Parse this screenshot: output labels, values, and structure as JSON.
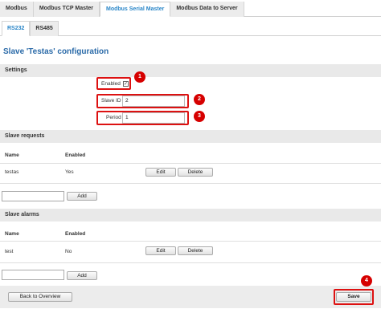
{
  "top_tabs": [
    "Modbus",
    "Modbus TCP Master",
    "Modbus Serial Master",
    "Modbus Data to Server"
  ],
  "sub_tabs": [
    "RS232",
    "RS485"
  ],
  "page_title": "Slave 'Testas' configuration",
  "settings": {
    "heading": "Settings",
    "enabled_label": "Enabled",
    "enabled_checked": true,
    "slave_id_label": "Slave ID",
    "slave_id_value": "2",
    "period_label": "Period",
    "period_value": "1"
  },
  "markers": [
    "1",
    "2",
    "3",
    "4"
  ],
  "slave_requests": {
    "heading": "Slave requests",
    "col_name": "Name",
    "col_enabled": "Enabled",
    "rows": [
      {
        "name": "testas",
        "enabled": "Yes"
      }
    ],
    "edit_label": "Edit",
    "delete_label": "Delete",
    "add_label": "Add",
    "add_placeholder": ""
  },
  "slave_alarms": {
    "heading": "Slave alarms",
    "col_name": "Name",
    "col_enabled": "Enabled",
    "rows": [
      {
        "name": "test",
        "enabled": "No"
      }
    ],
    "edit_label": "Edit",
    "delete_label": "Delete",
    "add_label": "Add",
    "add_placeholder": ""
  },
  "footer": {
    "back_label": "Back to Overview",
    "save_label": "Save"
  },
  "colors": {
    "accent": "#2a86c8",
    "title": "#2a6aa8",
    "marker": "#d60000"
  }
}
